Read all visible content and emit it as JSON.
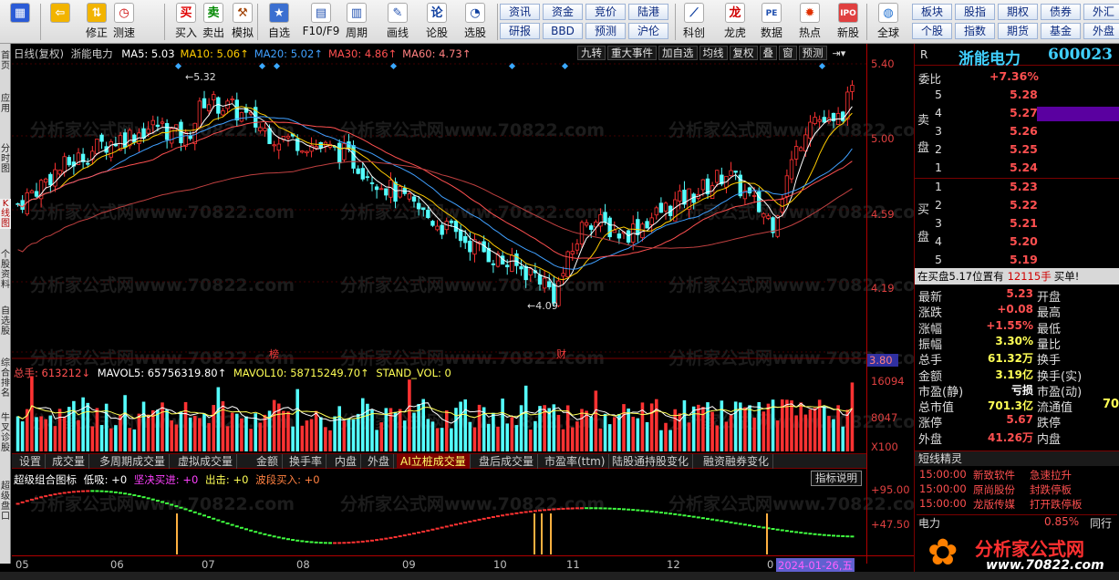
{
  "toolbar": {
    "buttons": [
      {
        "label": "",
        "icon": "grid-icon"
      },
      {
        "label": "",
        "icon": "back-arrow-icon"
      },
      {
        "label": "修正",
        "icon": "up-down-arrows-icon"
      },
      {
        "label": "测速",
        "icon": "clock-icon"
      },
      {
        "label": "买入",
        "icon": "buy-icon"
      },
      {
        "label": "卖出",
        "icon": "sell-icon"
      },
      {
        "label": "模拟",
        "icon": "hammer-icon"
      },
      {
        "label": "自选",
        "icon": "star-icon"
      },
      {
        "label": "F10/F9",
        "icon": "f10-icon"
      },
      {
        "label": "周期",
        "icon": "period-icon"
      },
      {
        "label": "画线",
        "icon": "pencil-icon"
      },
      {
        "label": "论股",
        "icon": "chat-icon"
      },
      {
        "label": "选股",
        "icon": "filter-icon"
      },
      {
        "label": "科创",
        "icon": "chart-icon"
      },
      {
        "label": "龙虎",
        "icon": "dragon-icon"
      },
      {
        "label": "数据",
        "icon": "pe-icon"
      },
      {
        "label": "热点",
        "icon": "fire-icon"
      },
      {
        "label": "新股",
        "icon": "ipo-icon"
      },
      {
        "label": "全球",
        "icon": "globe-icon"
      }
    ],
    "small_buttons": [
      [
        "资讯",
        "资金",
        "竞价",
        "陆港"
      ],
      [
        "研报",
        "BBD",
        "预测",
        "沪伦"
      ],
      [
        "板块",
        "股指",
        "期权",
        "债券",
        "外汇"
      ],
      [
        "个股",
        "指数",
        "期货",
        "基金",
        "外盘"
      ]
    ]
  },
  "left_tabs": [
    "首页",
    "应用",
    "分时图",
    "K线图",
    "个股资料",
    "自选股",
    "综合排名",
    "牛叉诊股",
    "超级盘口"
  ],
  "chart": {
    "header": [
      "日线(复权)",
      "浙能电力"
    ],
    "ma_legend": [
      {
        "text": "MA5: 5.03",
        "color": "#ffffff"
      },
      {
        "text": "MA10: 5.06↑",
        "color": "#ffcc00"
      },
      {
        "text": "MA20: 5.02↑",
        "color": "#40a0ff"
      },
      {
        "text": "MA30: 4.86↑",
        "color": "#ff5050"
      },
      {
        "text": "MA60: 4.73↑",
        "color": "#ff8080"
      }
    ],
    "top_buttons": [
      "九转",
      "重大事件",
      "加自选",
      "均线",
      "复权",
      "叠",
      "窗",
      "预测"
    ],
    "price_high_label": "5.32",
    "price_low_label": "4.09",
    "event_marks": [
      "榜",
      "财"
    ],
    "volume_legend": {
      "total": "总手: 613212↓",
      "mavol5": "MAVOL5: 65756319.80↑",
      "mavol10": "MAVOL10: 58715249.70↑",
      "stand": "STAND_VOL: 0"
    },
    "indicator_legend": {
      "name": "超级组合图标",
      "low": "低吸: +0",
      "buy": "坚决买进: +0",
      "out": "出击: +0",
      "wave": "波段买入: +0"
    },
    "indicator_button": "指标说明",
    "tabs": [
      "设置",
      "成交量",
      "多周期成交量",
      "虚拟成交量",
      "金额",
      "换手率",
      "内盘",
      "外盘",
      "AI立桩成交量",
      "盘后成交量",
      "市盈率(ttm)",
      "陆股通持股变化",
      "融资融券变化"
    ],
    "active_tab": "AI立桩成交量",
    "watermark": "分析家公式网www.70822.com"
  },
  "axis": {
    "price_labels": [
      "5.40",
      "5.00",
      "4.59",
      "4.19",
      "3.80"
    ],
    "volume_labels": [
      "16094",
      "8047",
      "X100"
    ],
    "indicator_labels": [
      "+95.00",
      "+47.50"
    ]
  },
  "dates": [
    "05",
    "06",
    "07",
    "08",
    "09",
    "10",
    "11",
    "12",
    "0",
    "2024-01-26,五"
  ],
  "panel": {
    "r_label": "R",
    "stock_name": "浙能电力",
    "stock_code": "600023",
    "weibi_label": "委比",
    "weibi_value": "+7.36%",
    "sell_label": "卖盘",
    "buy_label": "买盘",
    "sell_levels": [
      {
        "n": "5",
        "p": "5.28"
      },
      {
        "n": "4",
        "p": "5.27"
      },
      {
        "n": "3",
        "p": "5.26"
      },
      {
        "n": "2",
        "p": "5.25"
      },
      {
        "n": "1",
        "p": "5.24"
      }
    ],
    "buy_levels": [
      {
        "n": "1",
        "p": "5.23"
      },
      {
        "n": "2",
        "p": "5.22"
      },
      {
        "n": "3",
        "p": "5.21"
      },
      {
        "n": "4",
        "p": "5.20"
      },
      {
        "n": "5",
        "p": "5.19"
      }
    ],
    "notice": [
      "在买盘5.17位置有",
      "12115手",
      "买单!"
    ],
    "stats": [
      {
        "l1": "最新",
        "v1": "5.23",
        "l2": "开盘",
        "c": "#ff5050"
      },
      {
        "l1": "涨跌",
        "v1": "+0.08",
        "l2": "最高",
        "c": "#ff5050"
      },
      {
        "l1": "涨幅",
        "v1": "+1.55%",
        "l2": "最低",
        "c": "#ff5050"
      },
      {
        "l1": "振幅",
        "v1": "3.30%",
        "l2": "量比",
        "c": "#ffff55"
      },
      {
        "l1": "总手",
        "v1": "61.32万",
        "l2": "换手",
        "c": "#ffff55"
      },
      {
        "l1": "金额",
        "v1": "3.19亿",
        "l2": "换手(实)",
        "c": "#ffff55"
      },
      {
        "l1": "市盈(静)",
        "v1": "亏损",
        "l2": "市盈(动)",
        "c": "#ffffff"
      },
      {
        "l1": "总市值",
        "v1": "701.3亿",
        "l2": "流通值",
        "c": "#ffff55"
      },
      {
        "l1": "涨停",
        "v1": "5.67",
        "l2": "跌停",
        "c": "#ff5050"
      },
      {
        "l1": "外盘",
        "v1": "41.26万",
        "l2": "内盘",
        "c": "#ff5050"
      }
    ],
    "liutong_partial": "70",
    "news_title": "短线精灵",
    "news": [
      {
        "time": "15:00:00",
        "name": "新致软件",
        "event": "急速拉升"
      },
      {
        "time": "15:00:00",
        "name": "原尚股份",
        "event": "封跌停板"
      },
      {
        "time": "15:00:00",
        "name": "龙版传媒",
        "event": "打开跌停板"
      }
    ],
    "sector_row": {
      "name": "电力",
      "pct": "0.85%",
      "next": "同行"
    },
    "logo_text": "分析家公式网",
    "logo_url": "www.70822.com"
  }
}
